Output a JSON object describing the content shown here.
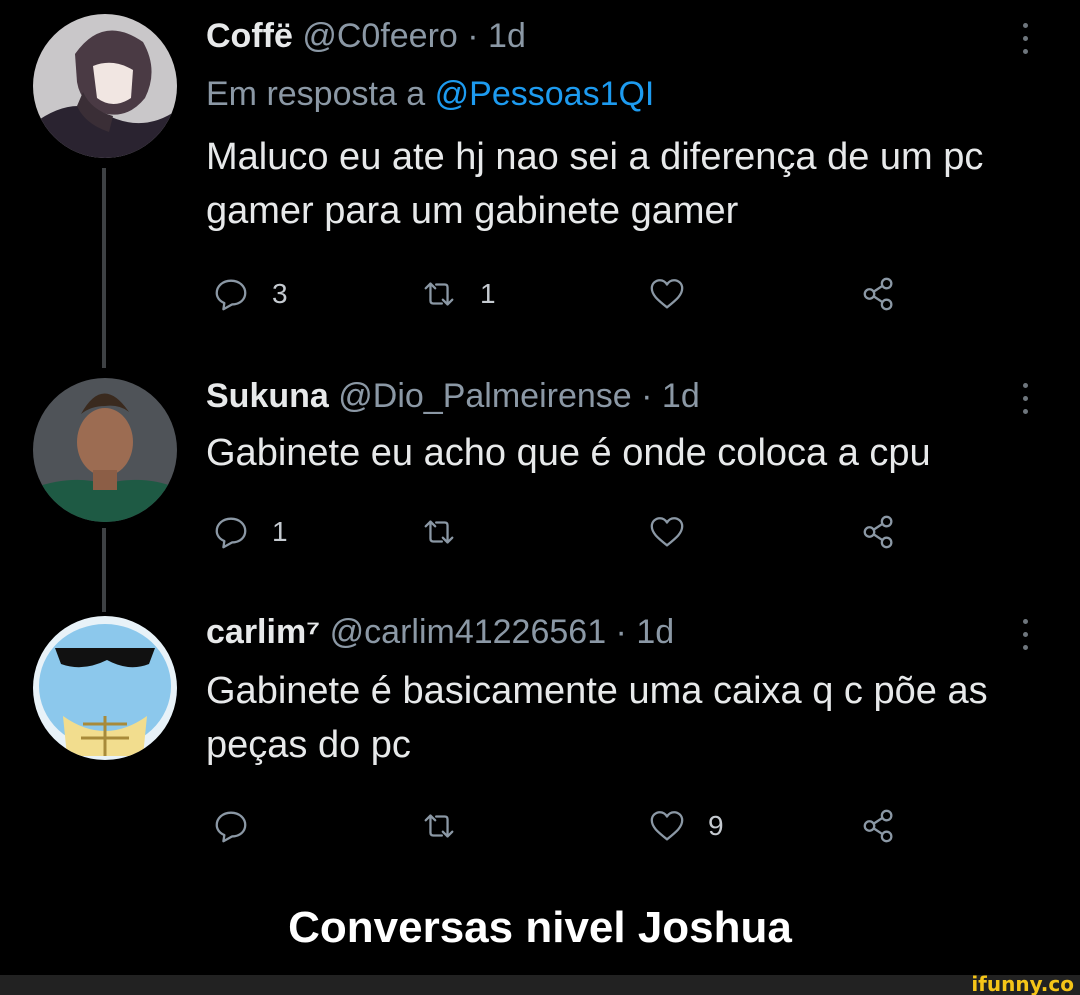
{
  "tweets": [
    {
      "name": "Coffë",
      "handle": "@C0feero",
      "time": "1d",
      "reply_prefix": "Em resposta a ",
      "reply_mention": "@Pessoas1QI",
      "text": "Maluco eu ate hj nao sei a diferença de um pc gamer para um gabinete gamer",
      "replies": "3",
      "retweets": "1",
      "likes": ""
    },
    {
      "name": "Sukuna",
      "handle": "@Dio_Palmeirense",
      "time": "1d",
      "text": "Gabinete eu acho que é onde coloca a cpu",
      "replies": "1",
      "retweets": "",
      "likes": ""
    },
    {
      "name": "carlim⁷",
      "handle": "@carlim41226561",
      "time": "1d",
      "text": "Gabinete é basicamente uma caixa q c põe as peças do pc",
      "replies": "",
      "retweets": "",
      "likes": "9"
    }
  ],
  "separator": " · ",
  "caption": "Conversas nivel Joshua",
  "watermark": "ifunny.co",
  "icons": [
    "reply-icon",
    "retweet-icon",
    "like-icon",
    "share-icon",
    "more-options-icon"
  ]
}
